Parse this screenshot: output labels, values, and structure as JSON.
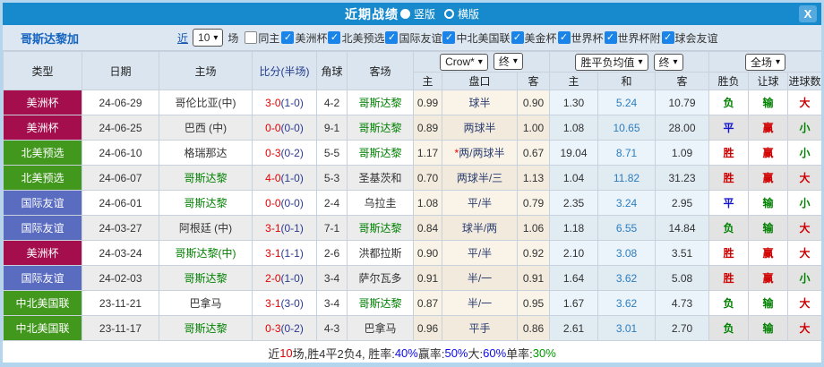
{
  "titlebar": {
    "title": "近期战绩",
    "vertical_label": "竖版",
    "horizontal_label": "横版",
    "close_label": "X"
  },
  "filter": {
    "team": "哥斯达黎加",
    "near_label": "近",
    "match_count": "10",
    "unit_label": "场",
    "same_home_label": "同主",
    "same_home_checked": false,
    "competitions": [
      "美洲杯",
      "北美预选",
      "国际友谊",
      "中北美国联",
      "美金杯",
      "世界杯",
      "世界杯附",
      "球会友谊"
    ]
  },
  "table": {
    "headers": {
      "type": "类型",
      "date": "日期",
      "home": "主场",
      "score": "比分(半场)",
      "corner": "角球",
      "away": "客场",
      "sub": [
        "主",
        "盘口",
        "客",
        "主",
        "和",
        "客",
        "胜负",
        "让球",
        "进球数"
      ]
    },
    "selects": {
      "company": "Crow*",
      "company_period": "终",
      "avg": "胜平负均值",
      "avg_period": "终",
      "scope": "全场"
    },
    "rows": [
      {
        "type": "美洲杯",
        "type_color": "crimson",
        "date": "24-06-29",
        "home": "哥伦比亚(中)",
        "home_highlight": false,
        "score": "3-0",
        "half": "(1-0)",
        "corner": "4-2",
        "away": "哥斯达黎",
        "away_highlight": true,
        "odds_home": "0.99",
        "handicap": "球半",
        "handicap_star": false,
        "odds_away": "0.90",
        "avg_win": "1.30",
        "avg_draw": "5.24",
        "avg_lose": "10.79",
        "result_wdl": "负",
        "result_wdl_color": "green",
        "result_handicap": "输",
        "result_handicap_color": "green",
        "result_goals": "大",
        "result_goals_color": "red"
      },
      {
        "type": "美洲杯",
        "type_color": "crimson",
        "date": "24-06-25",
        "home": "巴西 (中)",
        "home_highlight": false,
        "score": "0-0",
        "half": "(0-0)",
        "corner": "9-1",
        "away": "哥斯达黎",
        "away_highlight": true,
        "odds_home": "0.89",
        "handicap": "两球半",
        "handicap_star": false,
        "odds_away": "1.00",
        "avg_win": "1.08",
        "avg_draw": "10.65",
        "avg_lose": "28.00",
        "result_wdl": "平",
        "result_wdl_color": "blue",
        "result_handicap": "赢",
        "result_handicap_color": "red",
        "result_goals": "小",
        "result_goals_color": "green"
      },
      {
        "type": "北美预选",
        "type_color": "green",
        "date": "24-06-10",
        "home": "格瑞那达",
        "home_highlight": false,
        "score": "0-3",
        "half": "(0-2)",
        "corner": "5-5",
        "away": "哥斯达黎",
        "away_highlight": true,
        "odds_home": "1.17",
        "handicap": "两/两球半",
        "handicap_star": true,
        "odds_away": "0.67",
        "avg_win": "19.04",
        "avg_draw": "8.71",
        "avg_lose": "1.09",
        "result_wdl": "胜",
        "result_wdl_color": "red",
        "result_handicap": "赢",
        "result_handicap_color": "red",
        "result_goals": "小",
        "result_goals_color": "green"
      },
      {
        "type": "北美预选",
        "type_color": "green",
        "date": "24-06-07",
        "home": "哥斯达黎",
        "home_highlight": true,
        "score": "4-0",
        "half": "(1-0)",
        "corner": "5-3",
        "away": "圣基茨和",
        "away_highlight": false,
        "odds_home": "0.70",
        "handicap": "两球半/三",
        "handicap_star": false,
        "odds_away": "1.13",
        "avg_win": "1.04",
        "avg_draw": "11.82",
        "avg_lose": "31.23",
        "result_wdl": "胜",
        "result_wdl_color": "red",
        "result_handicap": "赢",
        "result_handicap_color": "red",
        "result_goals": "大",
        "result_goals_color": "red"
      },
      {
        "type": "国际友谊",
        "type_color": "blue",
        "date": "24-06-01",
        "home": "哥斯达黎",
        "home_highlight": true,
        "score": "0-0",
        "half": "(0-0)",
        "corner": "2-4",
        "away": "乌拉圭",
        "away_highlight": false,
        "odds_home": "1.08",
        "handicap": "平/半",
        "handicap_star": false,
        "odds_away": "0.79",
        "avg_win": "2.35",
        "avg_draw": "3.24",
        "avg_lose": "2.95",
        "result_wdl": "平",
        "result_wdl_color": "blue",
        "result_handicap": "输",
        "result_handicap_color": "green",
        "result_goals": "小",
        "result_goals_color": "green"
      },
      {
        "type": "国际友谊",
        "type_color": "blue",
        "date": "24-03-27",
        "home": "阿根廷 (中)",
        "home_highlight": false,
        "score": "3-1",
        "half": "(0-1)",
        "corner": "7-1",
        "away": "哥斯达黎",
        "away_highlight": true,
        "odds_home": "0.84",
        "handicap": "球半/两",
        "handicap_star": false,
        "odds_away": "1.06",
        "avg_win": "1.18",
        "avg_draw": "6.55",
        "avg_lose": "14.84",
        "result_wdl": "负",
        "result_wdl_color": "green",
        "result_handicap": "输",
        "result_handicap_color": "green",
        "result_goals": "大",
        "result_goals_color": "red"
      },
      {
        "type": "美洲杯",
        "type_color": "crimson",
        "date": "24-03-24",
        "home": "哥斯达黎(中)",
        "home_highlight": true,
        "score": "3-1",
        "half": "(1-1)",
        "corner": "2-6",
        "away": "洪都拉斯",
        "away_highlight": false,
        "odds_home": "0.90",
        "handicap": "平/半",
        "handicap_star": false,
        "odds_away": "0.92",
        "avg_win": "2.10",
        "avg_draw": "3.08",
        "avg_lose": "3.51",
        "result_wdl": "胜",
        "result_wdl_color": "red",
        "result_handicap": "赢",
        "result_handicap_color": "red",
        "result_goals": "大",
        "result_goals_color": "red"
      },
      {
        "type": "国际友谊",
        "type_color": "blue",
        "date": "24-02-03",
        "home": "哥斯达黎",
        "home_highlight": true,
        "score": "2-0",
        "half": "(1-0)",
        "corner": "3-4",
        "away": "萨尔瓦多",
        "away_highlight": false,
        "odds_home": "0.91",
        "handicap": "半/一",
        "handicap_star": false,
        "odds_away": "0.91",
        "avg_win": "1.64",
        "avg_draw": "3.62",
        "avg_lose": "5.08",
        "result_wdl": "胜",
        "result_wdl_color": "red",
        "result_handicap": "赢",
        "result_handicap_color": "red",
        "result_goals": "小",
        "result_goals_color": "green"
      },
      {
        "type": "中北美国联",
        "type_color": "green",
        "date": "23-11-21",
        "home": "巴拿马",
        "home_highlight": false,
        "score": "3-1",
        "half": "(3-0)",
        "corner": "3-4",
        "away": "哥斯达黎",
        "away_highlight": true,
        "odds_home": "0.87",
        "handicap": "半/一",
        "handicap_star": false,
        "odds_away": "0.95",
        "avg_win": "1.67",
        "avg_draw": "3.62",
        "avg_lose": "4.73",
        "result_wdl": "负",
        "result_wdl_color": "green",
        "result_handicap": "输",
        "result_handicap_color": "green",
        "result_goals": "大",
        "result_goals_color": "red"
      },
      {
        "type": "中北美国联",
        "type_color": "green",
        "date": "23-11-17",
        "home": "哥斯达黎",
        "home_highlight": true,
        "score": "0-3",
        "half": "(0-2)",
        "corner": "4-3",
        "away": "巴拿马",
        "away_highlight": false,
        "odds_home": "0.96",
        "handicap": "平手",
        "handicap_star": false,
        "odds_away": "0.86",
        "avg_win": "2.61",
        "avg_draw": "3.01",
        "avg_lose": "2.70",
        "result_wdl": "负",
        "result_wdl_color": "green",
        "result_handicap": "输",
        "result_handicap_color": "green",
        "result_goals": "大",
        "result_goals_color": "red"
      }
    ]
  },
  "footer": {
    "segments": [
      {
        "text": "近",
        "color": "default"
      },
      {
        "text": "10",
        "color": "red"
      },
      {
        "text": "场,胜4平2负4, 胜率:",
        "color": "default"
      },
      {
        "text": "40%",
        "color": "blue"
      },
      {
        "text": " 赢率:",
        "color": "default"
      },
      {
        "text": "50%",
        "color": "blue"
      },
      {
        "text": " 大:",
        "color": "default"
      },
      {
        "text": "60%",
        "color": "blue"
      },
      {
        "text": " 单率:",
        "color": "default"
      },
      {
        "text": "30%",
        "color": "green"
      }
    ]
  },
  "colors": {
    "titlebar_blue": "#168acd",
    "badge_crimson": "#a50e4d",
    "badge_green": "#42971d",
    "badge_blue": "#5a6cc0",
    "team_green": "#008000",
    "score_red": "#e60000",
    "result_red": "#d10000",
    "result_green": "#008000",
    "result_blue": "#1414cc"
  }
}
